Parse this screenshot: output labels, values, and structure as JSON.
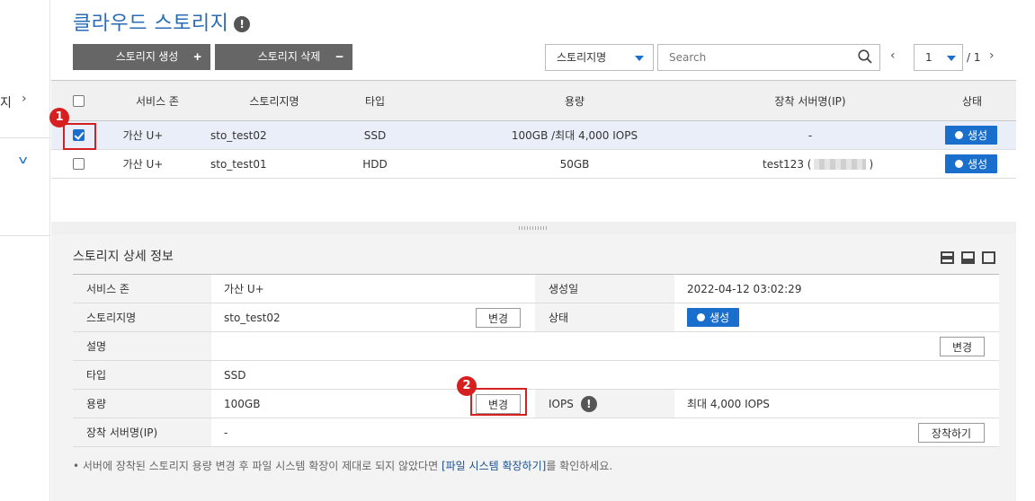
{
  "sidebar": {
    "item1_text": "지",
    "item1_chevron": "›",
    "item2_chevron": "v"
  },
  "page": {
    "title": "클라우드 스토리지",
    "title_info": "!"
  },
  "toolbar": {
    "create_label": "스토리지 생성",
    "create_sign": "+",
    "delete_label": "스토리지 삭제",
    "delete_sign": "−",
    "filter_value": "스토리지명",
    "search_placeholder": "Search"
  },
  "pager": {
    "prev": "‹",
    "next": "›",
    "current": "1",
    "total": "/ 1"
  },
  "grid": {
    "headers": [
      "서비스 존",
      "스토리지명",
      "타입",
      "용량",
      "장착 서버명(IP)",
      "상태"
    ],
    "rows": [
      {
        "selected": true,
        "zone": "가산 U+",
        "name": "sto_test02",
        "type": "SSD",
        "capacity": "100GB /최대 4,000 IOPS",
        "server": "-",
        "status": "생성"
      },
      {
        "selected": false,
        "zone": "가산 U+",
        "name": "sto_test01",
        "type": "HDD",
        "capacity": "50GB",
        "server": "test123 (",
        "server_suffix": ")",
        "status": "생성"
      }
    ]
  },
  "detail": {
    "title": "스토리지 상세 정보",
    "zone_label": "서비스 존",
    "zone_value": "가산 U+",
    "created_label": "생성일",
    "created_value": "2022-04-12 03:02:29",
    "name_label": "스토리지명",
    "name_value": "sto_test02",
    "name_change": "변경",
    "status_label": "상태",
    "status_value": "생성",
    "desc_label": "설명",
    "desc_change": "변경",
    "type_label": "타입",
    "type_value": "SSD",
    "capacity_label": "용량",
    "capacity_value": "100GB",
    "capacity_change": "변경",
    "iops_label": "IOPS",
    "iops_info": "!",
    "iops_value": "최대 4,000 IOPS",
    "server_label": "장착 서버명(IP)",
    "server_value": "-",
    "attach_label": "장착하기"
  },
  "note": {
    "prefix": "• 서버에 장착된 스토리지 용량 변경 후 파일 시스템 확장이 제대로 되지 않았다면 ",
    "link": "[파일 시스템 확장하기]",
    "suffix": "를 확인하세요."
  },
  "annotations": {
    "marker1": "1",
    "marker2": "2"
  },
  "colors": {
    "accent": "#1a6ecc",
    "title": "#2a6bb5",
    "dark_button": "#666666",
    "selected_row": "#e9eef8",
    "annotation": "#d62020"
  }
}
